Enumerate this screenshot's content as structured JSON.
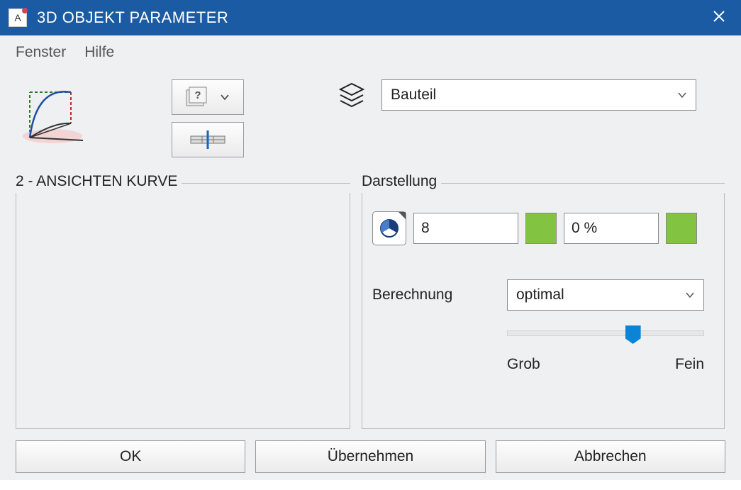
{
  "titlebar": {
    "title": "3D OBJEKT PARAMETER",
    "app_icon_letter": "A"
  },
  "menubar": {
    "window": "Fenster",
    "help": "Hilfe"
  },
  "top": {
    "layer_selected": "Bauteil"
  },
  "left_panel": {
    "title": "2 - ANSICHTEN KURVE"
  },
  "right_panel": {
    "title": "Darstellung",
    "pen_value": "8",
    "opacity_value": "0 %",
    "calc_label": "Berechnung",
    "calc_value": "optimal",
    "slider_min_label": "Grob",
    "slider_max_label": "Fein",
    "swatch_color": "#82c341"
  },
  "buttons": {
    "ok": "OK",
    "apply": "Übernehmen",
    "cancel": "Abbrechen"
  }
}
